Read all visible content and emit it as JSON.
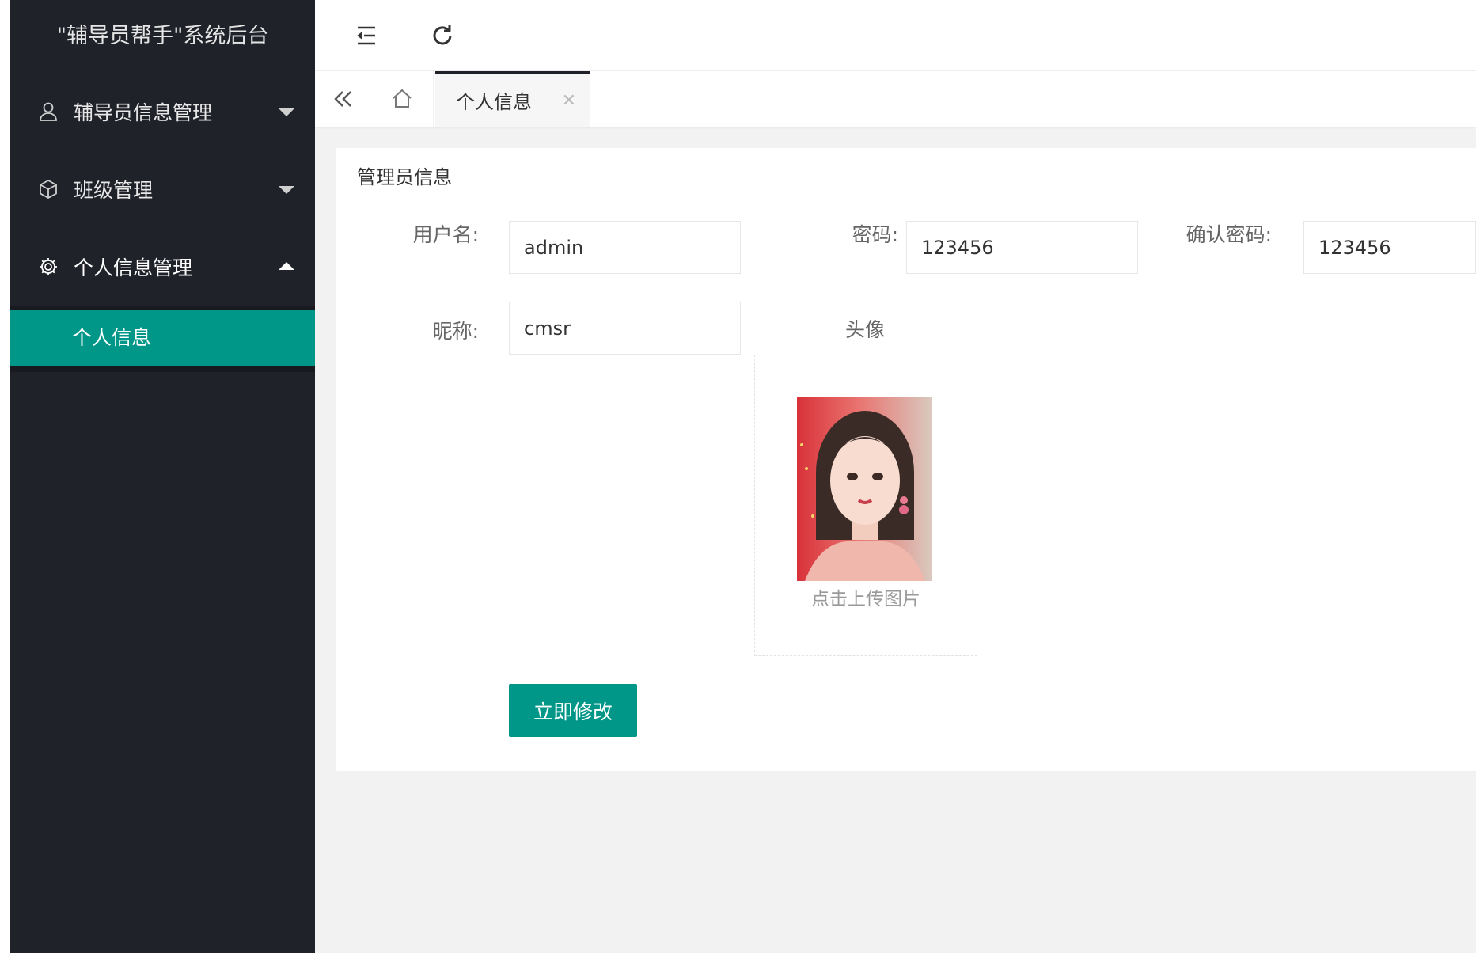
{
  "sidebar": {
    "title": "\"辅导员帮手\"系统后台",
    "menus": [
      {
        "label": "辅导员信息管理",
        "icon": "user-icon",
        "expanded": false
      },
      {
        "label": "班级管理",
        "icon": "cube-icon",
        "expanded": false
      },
      {
        "label": "个人信息管理",
        "icon": "gear-icon",
        "expanded": true,
        "children": [
          {
            "label": "个人信息",
            "active": true
          }
        ]
      }
    ],
    "accent_color": "#009688",
    "bg_color": "#20222a"
  },
  "header": {
    "fold_icon": "menu-fold-icon",
    "refresh_icon": "refresh-icon"
  },
  "tabs": {
    "back_icon": "double-chevron-left-icon",
    "home_icon": "home-icon",
    "items": [
      {
        "label": "个人信息",
        "active": true,
        "closable": true
      }
    ]
  },
  "form": {
    "card_title": "管理员信息",
    "username": {
      "label": "用户名:",
      "value": "admin"
    },
    "password": {
      "label": "密码:",
      "value": "123456"
    },
    "confirm_password": {
      "label": "确认密码:",
      "value": "123456"
    },
    "nickname": {
      "label": "昵称:",
      "value": "cmsr"
    },
    "avatar": {
      "label": "头像",
      "upload_text": "点击上传图片"
    },
    "submit_label": "立即修改"
  }
}
